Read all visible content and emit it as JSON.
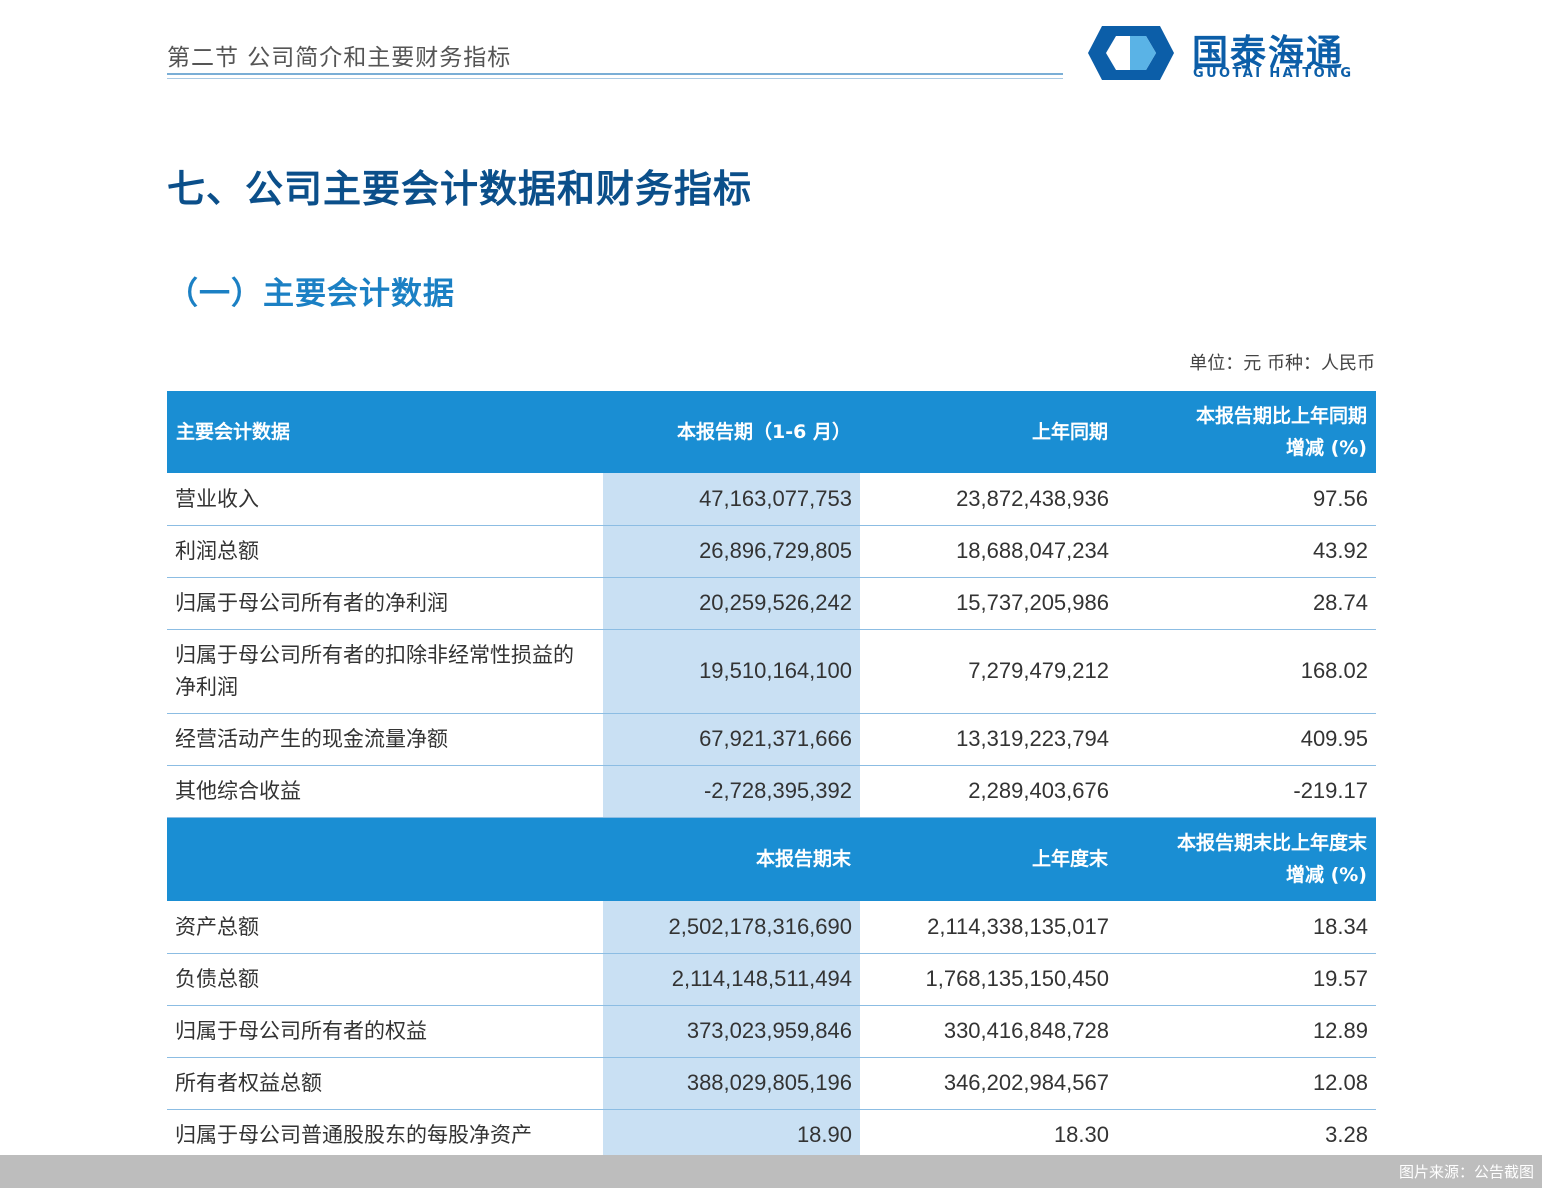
{
  "header": {
    "section_label": "第二节 公司简介和主要财务指标",
    "logo_cn": "国泰海通",
    "logo_en": "GUOTAI HAITONG",
    "colors": {
      "brand_blue": "#0c5ea8",
      "light_blue": "#5ab3e6"
    }
  },
  "titles": {
    "main": "七、公司主要会计数据和财务指标",
    "sub": "（一）主要会计数据",
    "unit_note": "单位：元 币种：人民币"
  },
  "table": {
    "header1": {
      "col1": "主要会计数据",
      "col2": "本报告期（1-6 月）",
      "col3": "上年同期",
      "col4_line1": "本报告期比上年同期",
      "col4_line2": "增减 (%)"
    },
    "rows1": [
      {
        "label": "营业收入",
        "current": "47,163,077,753",
        "prior": "23,872,438,936",
        "change": "97.56"
      },
      {
        "label": "利润总额",
        "current": "26,896,729,805",
        "prior": "18,688,047,234",
        "change": "43.92"
      },
      {
        "label": "归属于母公司所有者的净利润",
        "current": "20,259,526,242",
        "prior": "15,737,205,986",
        "change": "28.74"
      },
      {
        "label_line1": "归属于母公司所有者的扣除非经常性损益的",
        "label_line2": "净利润",
        "current": "19,510,164,100",
        "prior": "7,279,479,212",
        "change": "168.02"
      },
      {
        "label": "经营活动产生的现金流量净额",
        "current": "67,921,371,666",
        "prior": "13,319,223,794",
        "change": "409.95"
      },
      {
        "label": "其他综合收益",
        "current": "-2,728,395,392",
        "prior": "2,289,403,676",
        "change": "-219.17"
      }
    ],
    "header2": {
      "col1": "",
      "col2": "本报告期末",
      "col3": "上年度末",
      "col4_line1": "本报告期末比上年度末",
      "col4_line2": "增减 (%)"
    },
    "rows2": [
      {
        "label": "资产总额",
        "current": "2,502,178,316,690",
        "prior": "2,114,338,135,017",
        "change": "18.34"
      },
      {
        "label": "负债总额",
        "current": "2,114,148,511,494",
        "prior": "1,768,135,150,450",
        "change": "19.57"
      },
      {
        "label": "归属于母公司所有者的权益",
        "current": "373,023,959,846",
        "prior": "330,416,848,728",
        "change": "12.89"
      },
      {
        "label": "所有者权益总额",
        "current": "388,029,805,196",
        "prior": "346,202,984,567",
        "change": "12.08"
      },
      {
        "label": "归属于母公司普通股股东的每股净资产",
        "current": "18.90",
        "prior": "18.30",
        "change": "3.28"
      }
    ],
    "colors": {
      "header_bg": "#1a8ed3",
      "highlight_col": "#c9e0f3",
      "row_rule": "#8cbde3"
    }
  },
  "footer": {
    "source": "图片来源：公告截图"
  }
}
